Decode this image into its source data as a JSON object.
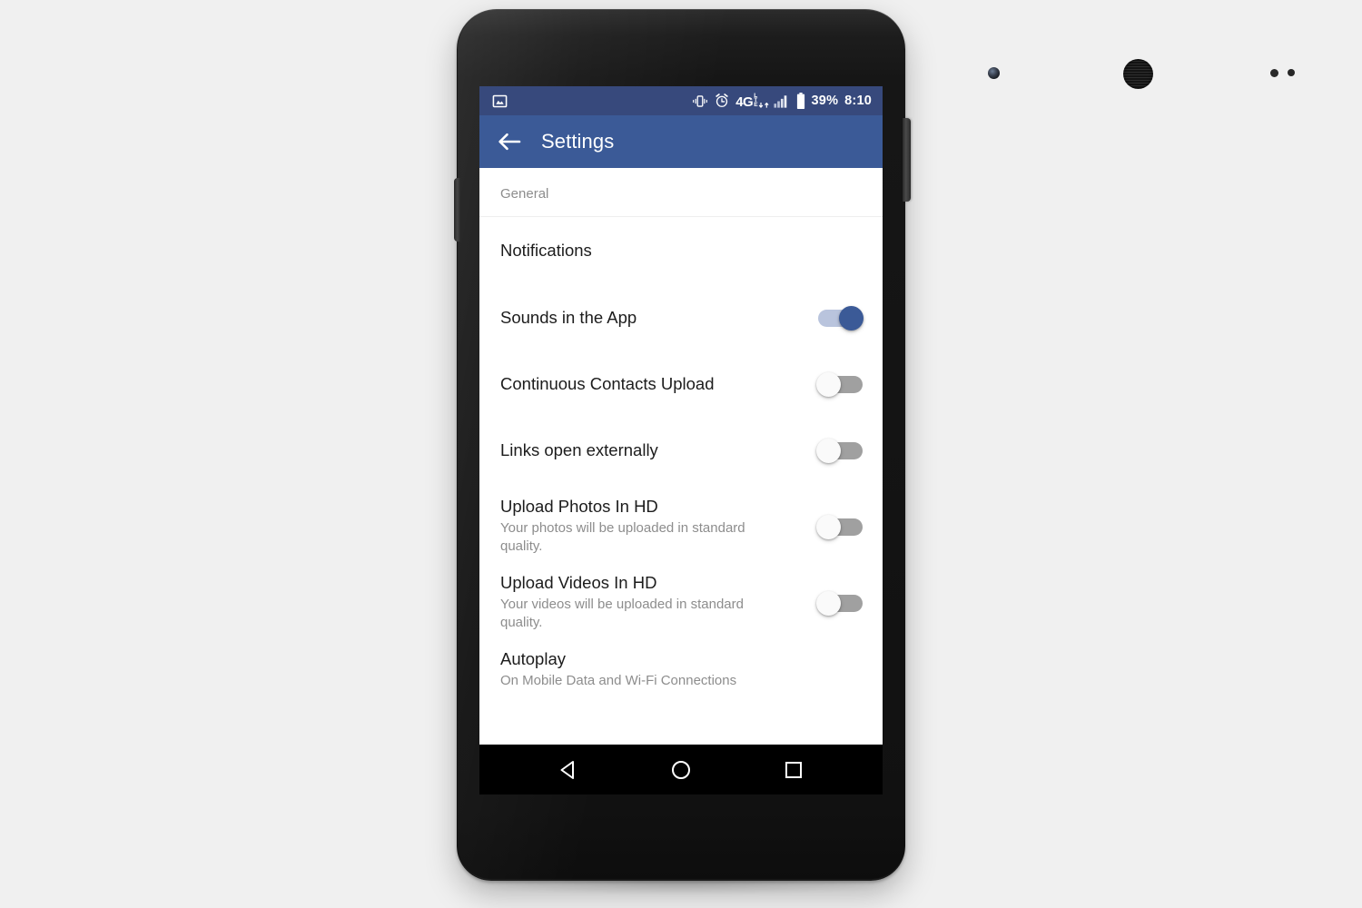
{
  "device": {
    "frame_label": "android-phone",
    "hardware": {
      "front_camera": "front-camera",
      "earpiece": "earpiece-speaker",
      "power_button": "power-button",
      "volume_button": "volume-button"
    }
  },
  "colors": {
    "page_background": "#f0f0f0",
    "status_bar": "#37497c",
    "app_bar": "#3b5a97",
    "accent": "#3b5a97",
    "switch_on_track": "#b9c4dd",
    "switch_off_track": "#a0a0a0",
    "primary_text": "#1c1c1c",
    "secondary_text": "#8d8d8d"
  },
  "status_bar": {
    "left_icons": [
      {
        "name": "screenshot-icon",
        "label": "screenshot"
      }
    ],
    "right_icons": [
      {
        "name": "vibrate-icon",
        "label": "vibrate mode"
      },
      {
        "name": "alarm-icon",
        "label": "alarm set"
      },
      {
        "name": "network-4g-lte-icon",
        "label": "4G LTE",
        "text": "4G"
      },
      {
        "name": "signal-bars-icon",
        "label": "signal strength"
      },
      {
        "name": "battery-icon",
        "label": "battery"
      }
    ],
    "battery_percent": "39%",
    "clock": "8:10"
  },
  "app_bar": {
    "back_label": "Back",
    "title": "Settings"
  },
  "settings": {
    "section_header": "General",
    "rows": [
      {
        "id": "notifications",
        "title": "Notifications",
        "subtitle": "",
        "control": "none"
      },
      {
        "id": "sounds-in-the-app",
        "title": "Sounds in the App",
        "subtitle": "",
        "control": "switch",
        "state": "on"
      },
      {
        "id": "continuous-contacts-upload",
        "title": "Continuous Contacts Upload",
        "subtitle": "",
        "control": "switch",
        "state": "off"
      },
      {
        "id": "links-open-externally",
        "title": "Links open externally",
        "subtitle": "",
        "control": "switch",
        "state": "off"
      },
      {
        "id": "upload-photos-in-hd",
        "title": "Upload Photos In HD",
        "subtitle": "Your photos will be uploaded in standard quality.",
        "control": "switch",
        "state": "off"
      },
      {
        "id": "upload-videos-in-hd",
        "title": "Upload Videos In HD",
        "subtitle": "Your videos will be uploaded in standard quality.",
        "control": "switch",
        "state": "off"
      },
      {
        "id": "autoplay",
        "title": "Autoplay",
        "subtitle": "On Mobile Data and Wi-Fi Connections",
        "control": "none"
      }
    ]
  },
  "navigation_bar": {
    "keys": [
      {
        "name": "back-nav-button",
        "label": "Back"
      },
      {
        "name": "home-nav-button",
        "label": "Home"
      },
      {
        "name": "recents-nav-button",
        "label": "Recent apps"
      }
    ]
  }
}
